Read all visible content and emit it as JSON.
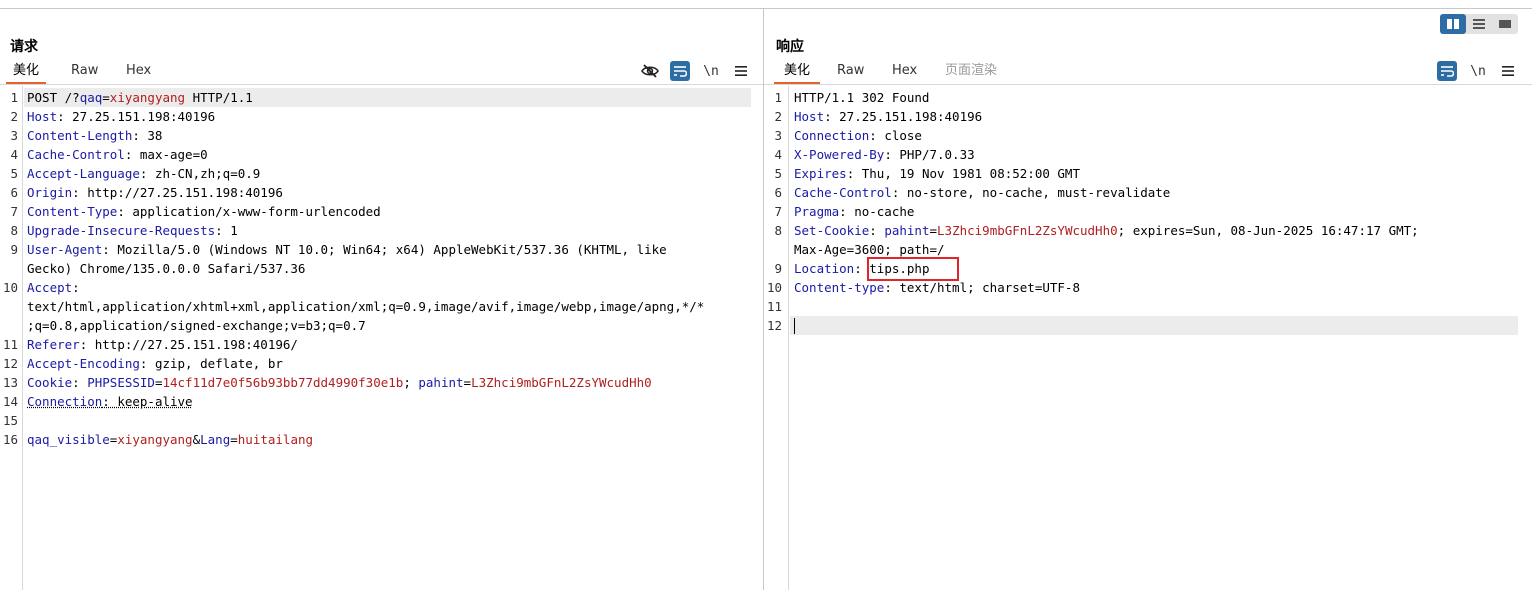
{
  "request": {
    "title": "请求",
    "tabs": [
      {
        "label": "美化",
        "active": true
      },
      {
        "label": "Raw",
        "active": false
      },
      {
        "label": "Hex",
        "active": false
      }
    ],
    "tools": {
      "hide_icon": "eye-off-icon",
      "wrap_icon": "wrap-lines-icon",
      "newline_label": "\\n",
      "menu_icon": "hamburger-menu-icon"
    },
    "lines": [
      {
        "n": "1"
      },
      {
        "n": "2"
      },
      {
        "n": "3"
      },
      {
        "n": "4"
      },
      {
        "n": "5"
      },
      {
        "n": "6"
      },
      {
        "n": "7"
      },
      {
        "n": "8"
      },
      {
        "n": "9"
      },
      {
        "n": "10"
      },
      {
        "n": "11"
      },
      {
        "n": "12"
      },
      {
        "n": "13"
      },
      {
        "n": "14"
      },
      {
        "n": "15"
      },
      {
        "n": "16"
      }
    ],
    "l1": {
      "method": "POST /?",
      "param": "qaq",
      "eq": "=",
      "value": "xiyangyang",
      "rest": " HTTP/1.1"
    },
    "l2": {
      "name": "Host",
      "value": ": 27.25.151.198:40196"
    },
    "l3": {
      "name": "Content-Length",
      "value": ": 38"
    },
    "l4": {
      "name": "Cache-Control",
      "value": ": max-age=0"
    },
    "l5": {
      "name": "Accept-Language",
      "value": ": zh-CN,zh;q=0.9"
    },
    "l6": {
      "name": "Origin",
      "value": ": http://27.25.151.198:40196"
    },
    "l7": {
      "name": "Content-Type",
      "value": ": application/x-www-form-urlencoded"
    },
    "l8": {
      "name": "Upgrade-Insecure-Requests",
      "value": ": 1"
    },
    "l9": {
      "name": "User-Agent",
      "value": ": Mozilla/5.0 (Windows NT 10.0; Win64; x64) AppleWebKit/537.36 (KHTML, like",
      "cont": "Gecko) Chrome/135.0.0.0 Safari/537.36"
    },
    "l10": {
      "name": "Accept",
      "value": ":",
      "cont1": "text/html,application/xhtml+xml,application/xml;q=0.9,image/avif,image/webp,image/apng,*/*",
      "cont2": ";q=0.8,application/signed-exchange;v=b3;q=0.7"
    },
    "l11": {
      "name": "Referer",
      "value": ": http://27.25.151.198:40196/"
    },
    "l12": {
      "name": "Accept-Encoding",
      "value": ": gzip, deflate, br"
    },
    "l13": {
      "name": "Cookie",
      "sep": ": ",
      "c1name": "PHPSESSID",
      "eq": "=",
      "c1val": "14cf11d7e0f56b93bb77dd4990f30e1b",
      "semi": "; ",
      "c2name": "pahint",
      "c2val": "L3Zhci9mbGFnL2ZsYWcudHh0"
    },
    "l14": {
      "name": "Connection",
      "value": ": keep-alive"
    },
    "l16": {
      "p1": "qaq_visible",
      "eq": "=",
      "v1": "xiyangyang",
      "amp": "&",
      "p2": "Lang",
      "v2": "huitailang"
    }
  },
  "response": {
    "title": "响应",
    "tabs": [
      {
        "label": "美化",
        "active": true
      },
      {
        "label": "Raw",
        "active": false
      },
      {
        "label": "Hex",
        "active": false
      },
      {
        "label": "页面渲染",
        "active": false
      }
    ],
    "tools": {
      "wrap_icon": "wrap-lines-icon",
      "newline_label": "\\n",
      "menu_icon": "hamburger-menu-icon"
    },
    "lines": [
      {
        "n": "1"
      },
      {
        "n": "2"
      },
      {
        "n": "3"
      },
      {
        "n": "4"
      },
      {
        "n": "5"
      },
      {
        "n": "6"
      },
      {
        "n": "7"
      },
      {
        "n": "8"
      },
      {
        "n": "9"
      },
      {
        "n": "10"
      },
      {
        "n": "11"
      },
      {
        "n": "12"
      }
    ],
    "l1": "HTTP/1.1 302 Found",
    "l2": {
      "name": "Host",
      "value": ": 27.25.151.198:40196"
    },
    "l3": {
      "name": "Connection",
      "value": ": close"
    },
    "l4": {
      "name": "X-Powered-By",
      "value": ": PHP/7.0.33"
    },
    "l5": {
      "name": "Expires",
      "value": ": Thu, 19 Nov 1981 08:52:00 GMT"
    },
    "l6": {
      "name": "Cache-Control",
      "value": ": no-store, no-cache, must-revalidate"
    },
    "l7": {
      "name": "Pragma",
      "value": ": no-cache"
    },
    "l8": {
      "name": "Set-Cookie",
      "sep": ": ",
      "cname": "pahint",
      "eq": "=",
      "cval": "L3Zhci9mbGFnL2ZsYWcudHh0",
      "rest": "; expires=Sun, 08-Jun-2025 16:47:17 GMT;",
      "cont": "Max-Age=3600; path=/"
    },
    "l9": {
      "name": "Location",
      "sep": ": ",
      "value": "tips.php"
    },
    "l10": {
      "name": "Content-type",
      "value": ": text/html; charset=UTF-8"
    }
  },
  "view_switch": {
    "icons": [
      "split-columns-icon",
      "split-rows-icon",
      "single-pane-icon"
    ],
    "active": 0
  },
  "colors": {
    "header_name": "#1a1aa6",
    "param_value": "#b01f1f",
    "accent": "#e8612c",
    "tool_blue": "#2e6da4",
    "highlight_box": "#e0262b"
  }
}
